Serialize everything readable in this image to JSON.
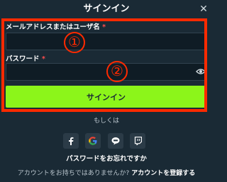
{
  "modal": {
    "title": "サインイン",
    "close_icon": "close-icon"
  },
  "form": {
    "username_label": "メールアドレスまたはユーザ名",
    "required_mark": "*",
    "username_value": "",
    "password_label": "パスワード",
    "password_value": "",
    "eye_icon": "eye-icon",
    "submit_label": "サインイン"
  },
  "annotations": {
    "marker_1": "①",
    "marker_2": "②",
    "highlight_color": "#ff2a00"
  },
  "alternatives": {
    "or_label": "もしくは",
    "social_icons": [
      "facebook-icon",
      "google-icon",
      "line-icon",
      "twitch-icon"
    ]
  },
  "footer": {
    "forgot_password": "パスワードをお忘れですか",
    "no_account_text": "アカウントをお持ちではありませんか?",
    "register_link": "アカウントを登録する"
  },
  "colors": {
    "background": "#1a2a35",
    "input_background": "#0f1c25",
    "button": "#8cf51a",
    "required": "#ff4d4d"
  }
}
